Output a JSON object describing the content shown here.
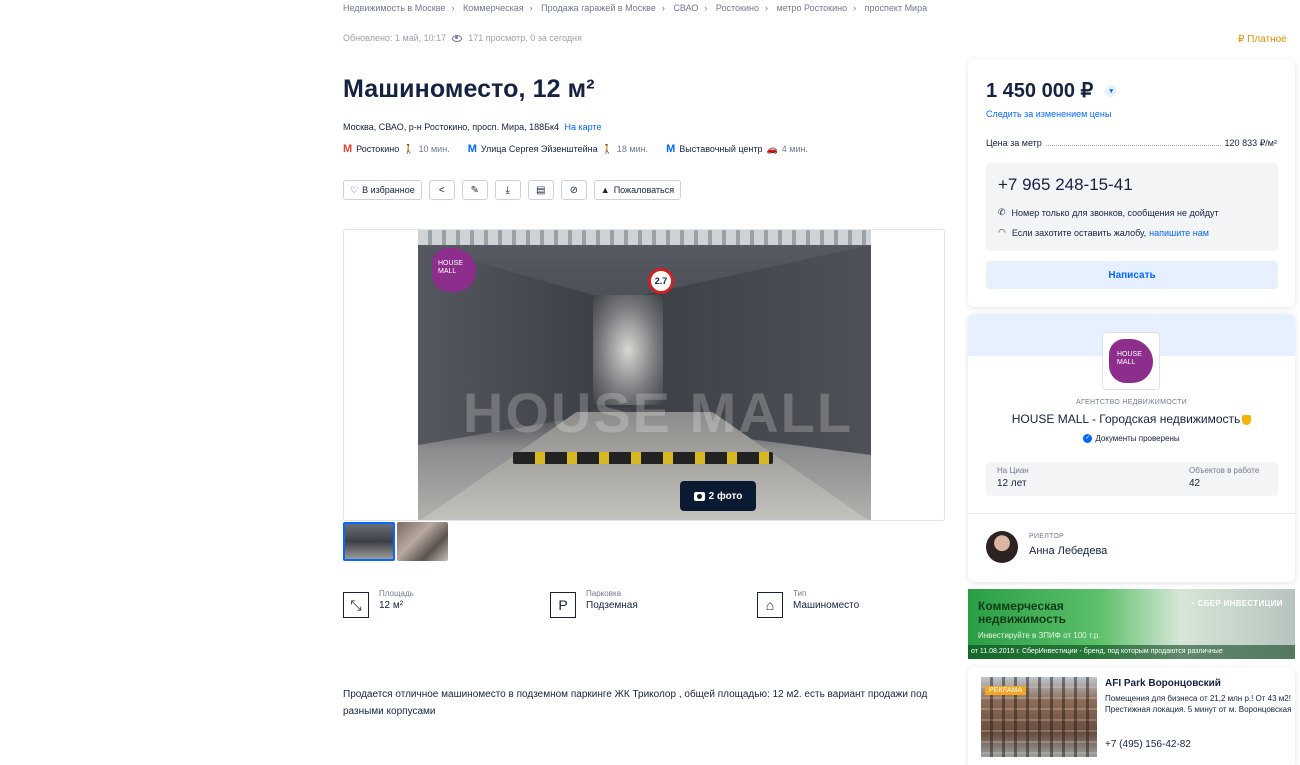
{
  "breadcrumb": [
    "Недвижимость в Москве",
    "Коммерческая",
    "Продажа гаражей в Москве",
    "СВАО",
    "Ростокино",
    "метро Ростокино",
    "проспект Мира"
  ],
  "meta": {
    "updated": "Обновлено: 1 май, 10:17",
    "views": "171 просмотр, 0 за сегодня"
  },
  "paid_label": "₽ Платное",
  "title": "Машиноместо, 12 м²",
  "address": {
    "text": "Москва, СВАО, р-н Ростокино, просп. Мира, 188Бк4",
    "map_link": "На карте"
  },
  "metro": [
    {
      "name": "Ростокино",
      "time": "10 мин.",
      "mode": "walk",
      "color": "#e4402f"
    },
    {
      "name": "Улица Сергея Эйзенштейна",
      "time": "18 мин.",
      "mode": "walk",
      "color": "#0468ff"
    },
    {
      "name": "Выставочный центр",
      "time": "4 мин.",
      "mode": "car",
      "color": "#0468ff"
    }
  ],
  "actions": {
    "favorite": "В избранное",
    "complain": "Пожаловаться"
  },
  "gallery": {
    "photo_count": "2 фото",
    "logo_text": "HOUSE MALL",
    "watermark": "HOUSE MALL",
    "sign": "2.7"
  },
  "features": [
    {
      "label": "Площадь",
      "value": "12 м²",
      "icon": "area-icon"
    },
    {
      "label": "Парковка",
      "value": "Подземная",
      "icon": "parking-icon"
    },
    {
      "label": "Тип",
      "value": "Машиноместо",
      "icon": "garage-icon"
    }
  ],
  "description": "Продается отличное  машиноместо в подземном паркинге ЖК Триколор , общей площадью: 12 м2. есть вариант продажи под разными корпусами",
  "price_card": {
    "price": "1 450 000 ₽",
    "follow": "Следить за изменением цены",
    "per_meter_label": "Цена за метр",
    "per_meter_value": "120 833 ₽/м²",
    "phone": "+7 965 248-15-41",
    "note1": "Номер только для звонков, сообщения не дойдут",
    "note2_text": "Если захотите оставить жалобу,",
    "note2_link": "напишите нам",
    "write_button": "Написать"
  },
  "agency": {
    "logo_text": "HOUSE MALL",
    "type": "АГЕНТСТВО НЕДВИЖИМОСТИ",
    "name": "HOUSE MALL - Городская недвижимость",
    "docs": "Документы проверены",
    "on_cian_label": "На Циан",
    "on_cian_value": "12 лет",
    "objects_label": "Объектов в работе",
    "objects_value": "42",
    "role": "РИЕЛТОР",
    "realtor": "Анна Лебедева"
  },
  "banner1": {
    "title_line1": "Коммерческая",
    "title_line2": "недвижимость",
    "sub": "Инвестируйте в ЗПИФ от 100 т.р.",
    "brand": "◔ СБЕР ИНВЕСТИЦИИ",
    "footer": "от 11.08.2015 г. СберИнвестиции - бренд, под которым продаются различные"
  },
  "banner2": {
    "tag": "РЕКЛАМА",
    "title": "AFI Park Воронцовский",
    "text": "Помещения для бизнеса от 21,2 млн р.! От 43 м2! Престижная локация. 5 минут от м. Воронцовская",
    "phone": "+7 (495) 156-42-82"
  }
}
